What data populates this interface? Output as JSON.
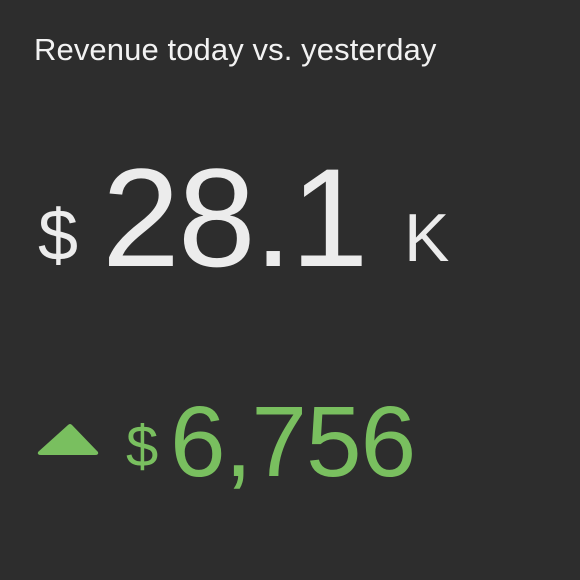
{
  "kpi_tile": {
    "title": "Revenue today vs. yesterday",
    "main_value": {
      "prefix": "$",
      "number": "28.1",
      "suffix": "K"
    },
    "delta": {
      "direction": "up",
      "icon": "triangle-up-icon",
      "prefix": "$",
      "number": "6,756"
    },
    "colors": {
      "background": "#2d2d2d",
      "title_text": "#f2f2f2",
      "main_value_text": "#ececec",
      "positive_delta": "#79bf5f"
    }
  }
}
